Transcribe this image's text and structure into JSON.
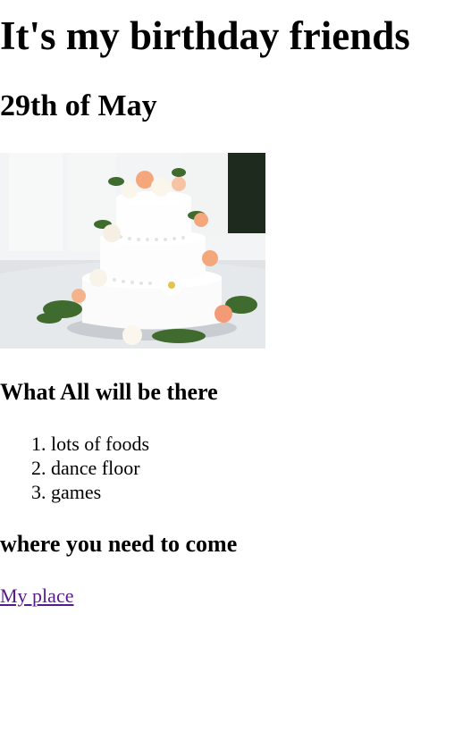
{
  "page": {
    "title": "It's my birthday friends",
    "date": "29th of May"
  },
  "image": {
    "alt": "wedding-style tiered cake with flowers"
  },
  "what_section": {
    "heading": "What All will be there",
    "items": [
      "lots of foods",
      "dance floor",
      "games"
    ]
  },
  "where_section": {
    "heading": "where you need to come",
    "link_label": "My place"
  },
  "colors": {
    "text": "#000000",
    "visited_link": "#551a8b",
    "background": "#ffffff"
  }
}
